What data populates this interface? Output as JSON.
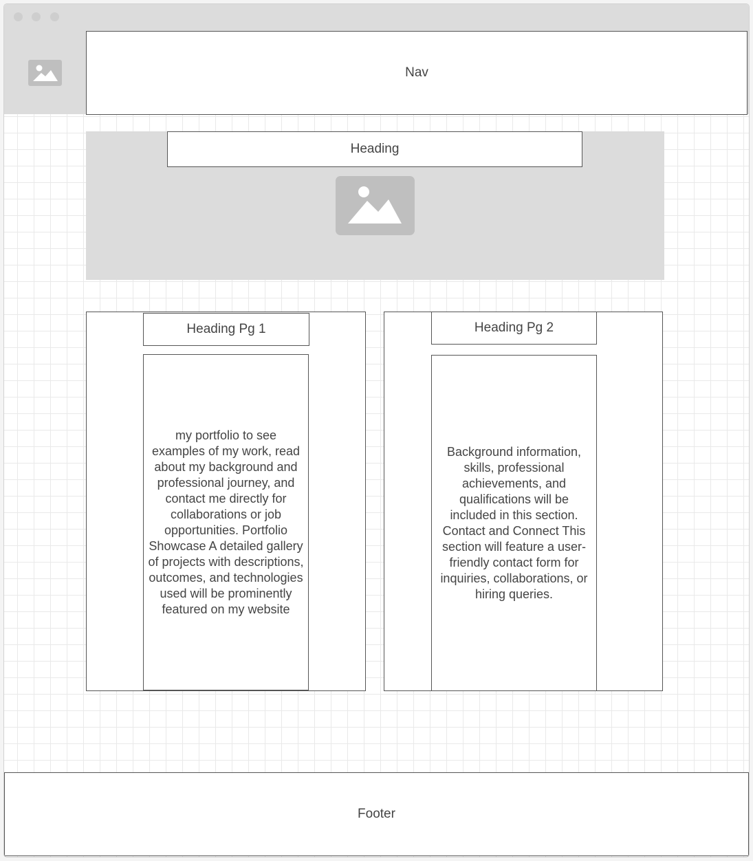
{
  "nav": {
    "label": "Nav"
  },
  "hero": {
    "heading": "Heading"
  },
  "cards": [
    {
      "heading": "Heading Pg 1",
      "body": "my portfolio to see examples of my work, read about my background and professional journey, and contact me directly for collaborations or job opportunities. Portfolio Showcase A detailed gallery of projects with descriptions, outcomes, and technologies used will be prominently featured on my website"
    },
    {
      "heading": "Heading Pg 2",
      "body": "Background information, skills, professional achievements, and qualifications will be included in this section. Contact and Connect This section will feature a user-friendly contact form for inquiries, collaborations, or hiring queries."
    }
  ],
  "footer": {
    "label": "Footer"
  },
  "icons": {
    "logo": "image-placeholder-icon",
    "hero_image": "image-placeholder-icon"
  },
  "colors": {
    "chrome": "#dcdcdc",
    "placeholder": "#bfbfbf",
    "border": "#555555",
    "text": "#444444"
  }
}
